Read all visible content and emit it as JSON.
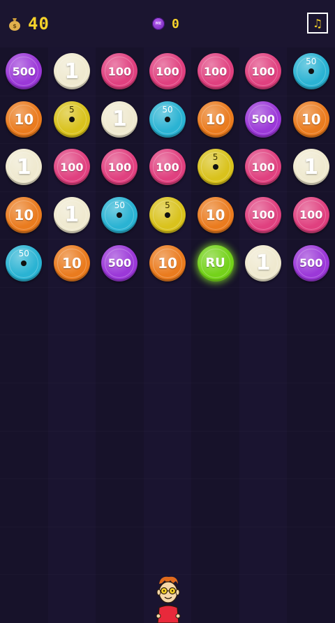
{
  "header": {
    "money_value": "40",
    "coin_badge_text": "ME",
    "coin_count": "0",
    "music_glyph": "♫"
  },
  "colors": {
    "c500": "#9b38d8",
    "c100": "#e0407f",
    "c50": "#2ab3d3",
    "c10": "#ea7b1e",
    "c5": "#d9c21c",
    "c1": "#efe9cf",
    "ru": "#74d21a"
  },
  "board": {
    "rows": [
      [
        "500",
        "1",
        "100",
        "100",
        "100",
        "100",
        "50"
      ],
      [
        "10",
        "5",
        "1",
        "50",
        "10",
        "500",
        "10"
      ],
      [
        "1",
        "100",
        "100",
        "100",
        "5",
        "100",
        "1"
      ],
      [
        "10",
        "1",
        "50",
        "5",
        "10",
        "100",
        "100"
      ],
      [
        "50",
        "10",
        "500",
        "10",
        "RU",
        "1",
        "500"
      ]
    ]
  }
}
